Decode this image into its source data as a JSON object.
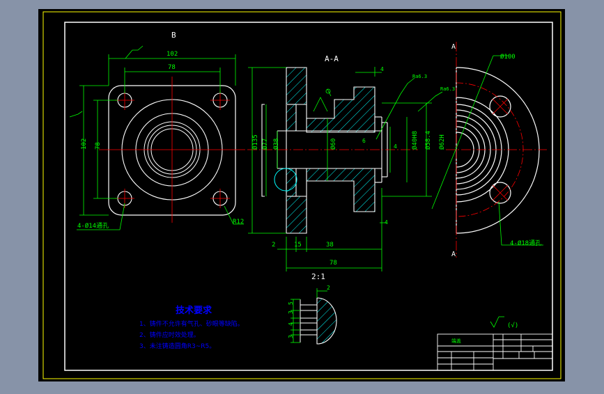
{
  "colors": {
    "background": "#8793a8",
    "paper": "#000000",
    "frame": "#ffff00",
    "outline": "#ffffff",
    "dimension": "#00ff00",
    "centerline": "#ff0000",
    "hatch": "#00ffff",
    "notes": "#0000ff"
  },
  "views": {
    "view_b_label": "B",
    "section_label": "A-A",
    "cut_label_top": "A",
    "cut_label_bottom": "A",
    "detail_scale": "2:1"
  },
  "dimensions": {
    "b_width_overall": "102",
    "b_width_holes": "78",
    "b_height_overall": "102",
    "b_height_holes": "78",
    "b_holes": "4-Ø14通孔",
    "b_corner_radius": "R12",
    "s_dia_135": "Ø135",
    "s_dia_77": "Ø77",
    "s_dia_38": "Ø38",
    "s_dia_60": "Ø60",
    "s_dia_40h8": "Ø40H8",
    "s_dia_58": "Ø58.4",
    "s_dia_62": "Ø62H",
    "s_roughness_1": "Ra6.3",
    "s_roughness_2": "Ra6.3",
    "s_top_step": "4",
    "s_right_step": "4",
    "s_bottom_step": "4",
    "s_len_2": "2",
    "s_len_15": "15",
    "s_len_38": "38",
    "s_len_78": "78",
    "s_detail_6": "6",
    "f_dia_100": "Ø100",
    "f_holes": "4-Ø18通孔",
    "d_top": "2",
    "d_5": "5",
    "d_3": "3",
    "d_4": "4",
    "d_3b": "3"
  },
  "notes": {
    "title": "技术要求",
    "lines": [
      "1、铸件不允许有气孔、砂眼等缺陷。",
      "2、铸件应时效处理。",
      "3、未注铸造圆角R3~R5。"
    ]
  },
  "surface_symbol": "(√)",
  "title_block": {
    "name_cell": "端盖"
  }
}
